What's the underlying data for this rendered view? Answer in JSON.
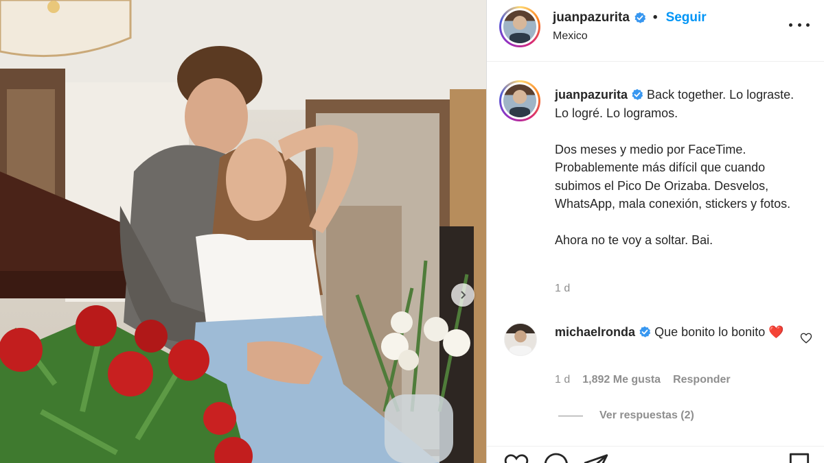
{
  "post": {
    "username": "juanpazurita",
    "follow_label": "Seguir",
    "separator": "•",
    "location": "Mexico"
  },
  "caption": {
    "username": "juanpazurita",
    "line1": "Back together. Lo lograste. Lo logré. Lo logramos.",
    "line2": "Dos meses y medio por FaceTime. Probablemente más difícil que cuando subimos el Pico De Orizaba. Desvelos, WhatsApp, mala conexión, stickers y fotos.",
    "line3": "Ahora no te voy a soltar. Bai.",
    "time": "1 d"
  },
  "comment": {
    "username": "michaelronda",
    "text": "Que bonito lo bonito",
    "emoji": "❤️",
    "time": "1 d",
    "likes": "1,892 Me gusta",
    "reply_label": "Responder",
    "view_replies": "Ver respuestas (2)"
  },
  "icons": {
    "verified": "verified-badge-icon",
    "more": "more-options-icon",
    "like": "heart-icon",
    "comment": "comment-icon",
    "share": "share-icon",
    "save": "bookmark-icon",
    "next": "chevron-right-icon"
  },
  "colors": {
    "accent": "#0095f6",
    "text": "#262626",
    "muted": "#8e8e8e",
    "heart": "#ed4956"
  }
}
